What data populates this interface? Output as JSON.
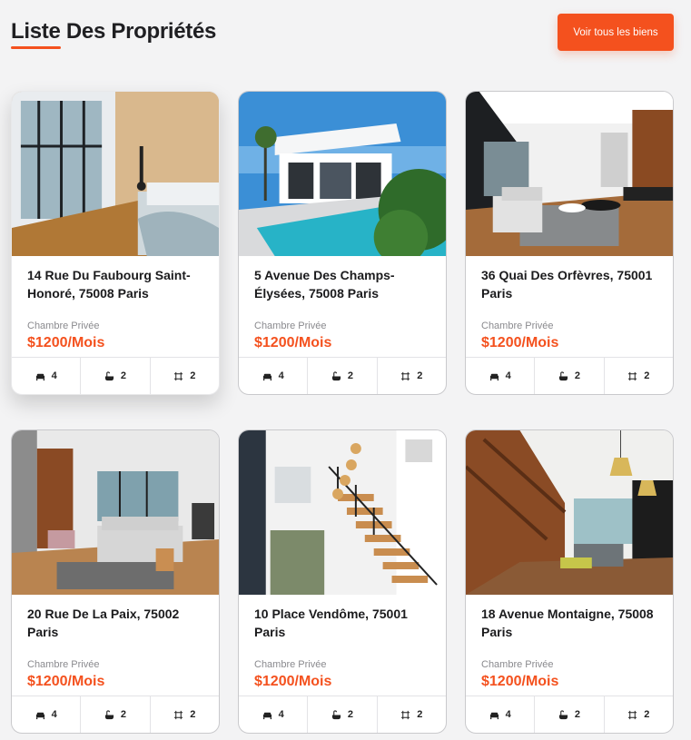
{
  "header": {
    "title": "Liste Des Propriétés",
    "view_all_label": "Voir tous les biens"
  },
  "colors": {
    "accent": "#f4511e",
    "background": "#f3f3f4"
  },
  "properties": [
    {
      "address": "14 Rue Du Faubourg Saint-Honoré, 75008 Paris",
      "type": "Chambre Privée",
      "price": "$1200/Mois",
      "beds": "4",
      "baths": "2",
      "area": "2",
      "image": "bedroom"
    },
    {
      "address": "5 Avenue Des Champs-Élysées, 75008 Paris",
      "type": "Chambre Privée",
      "price": "$1200/Mois",
      "beds": "4",
      "baths": "2",
      "area": "2",
      "image": "villa-pool"
    },
    {
      "address": "36 Quai Des Orfèvres, 75001 Paris",
      "type": "Chambre Privée",
      "price": "$1200/Mois",
      "beds": "4",
      "baths": "2",
      "area": "2",
      "image": "living-room"
    },
    {
      "address": "20 Rue De La Paix, 75002 Paris",
      "type": "Chambre Privée",
      "price": "$1200/Mois",
      "beds": "4",
      "baths": "2",
      "area": "2",
      "image": "lounge"
    },
    {
      "address": "10 Place Vendôme, 75001 Paris",
      "type": "Chambre Privée",
      "price": "$1200/Mois",
      "beds": "4",
      "baths": "2",
      "area": "2",
      "image": "staircase"
    },
    {
      "address": "18 Avenue Montaigne, 75008 Paris",
      "type": "Chambre Privée",
      "price": "$1200/Mois",
      "beds": "4",
      "baths": "2",
      "area": "2",
      "image": "open-plan"
    }
  ],
  "feature_icons": [
    "bed-icon",
    "bathtub-icon",
    "area-icon"
  ]
}
